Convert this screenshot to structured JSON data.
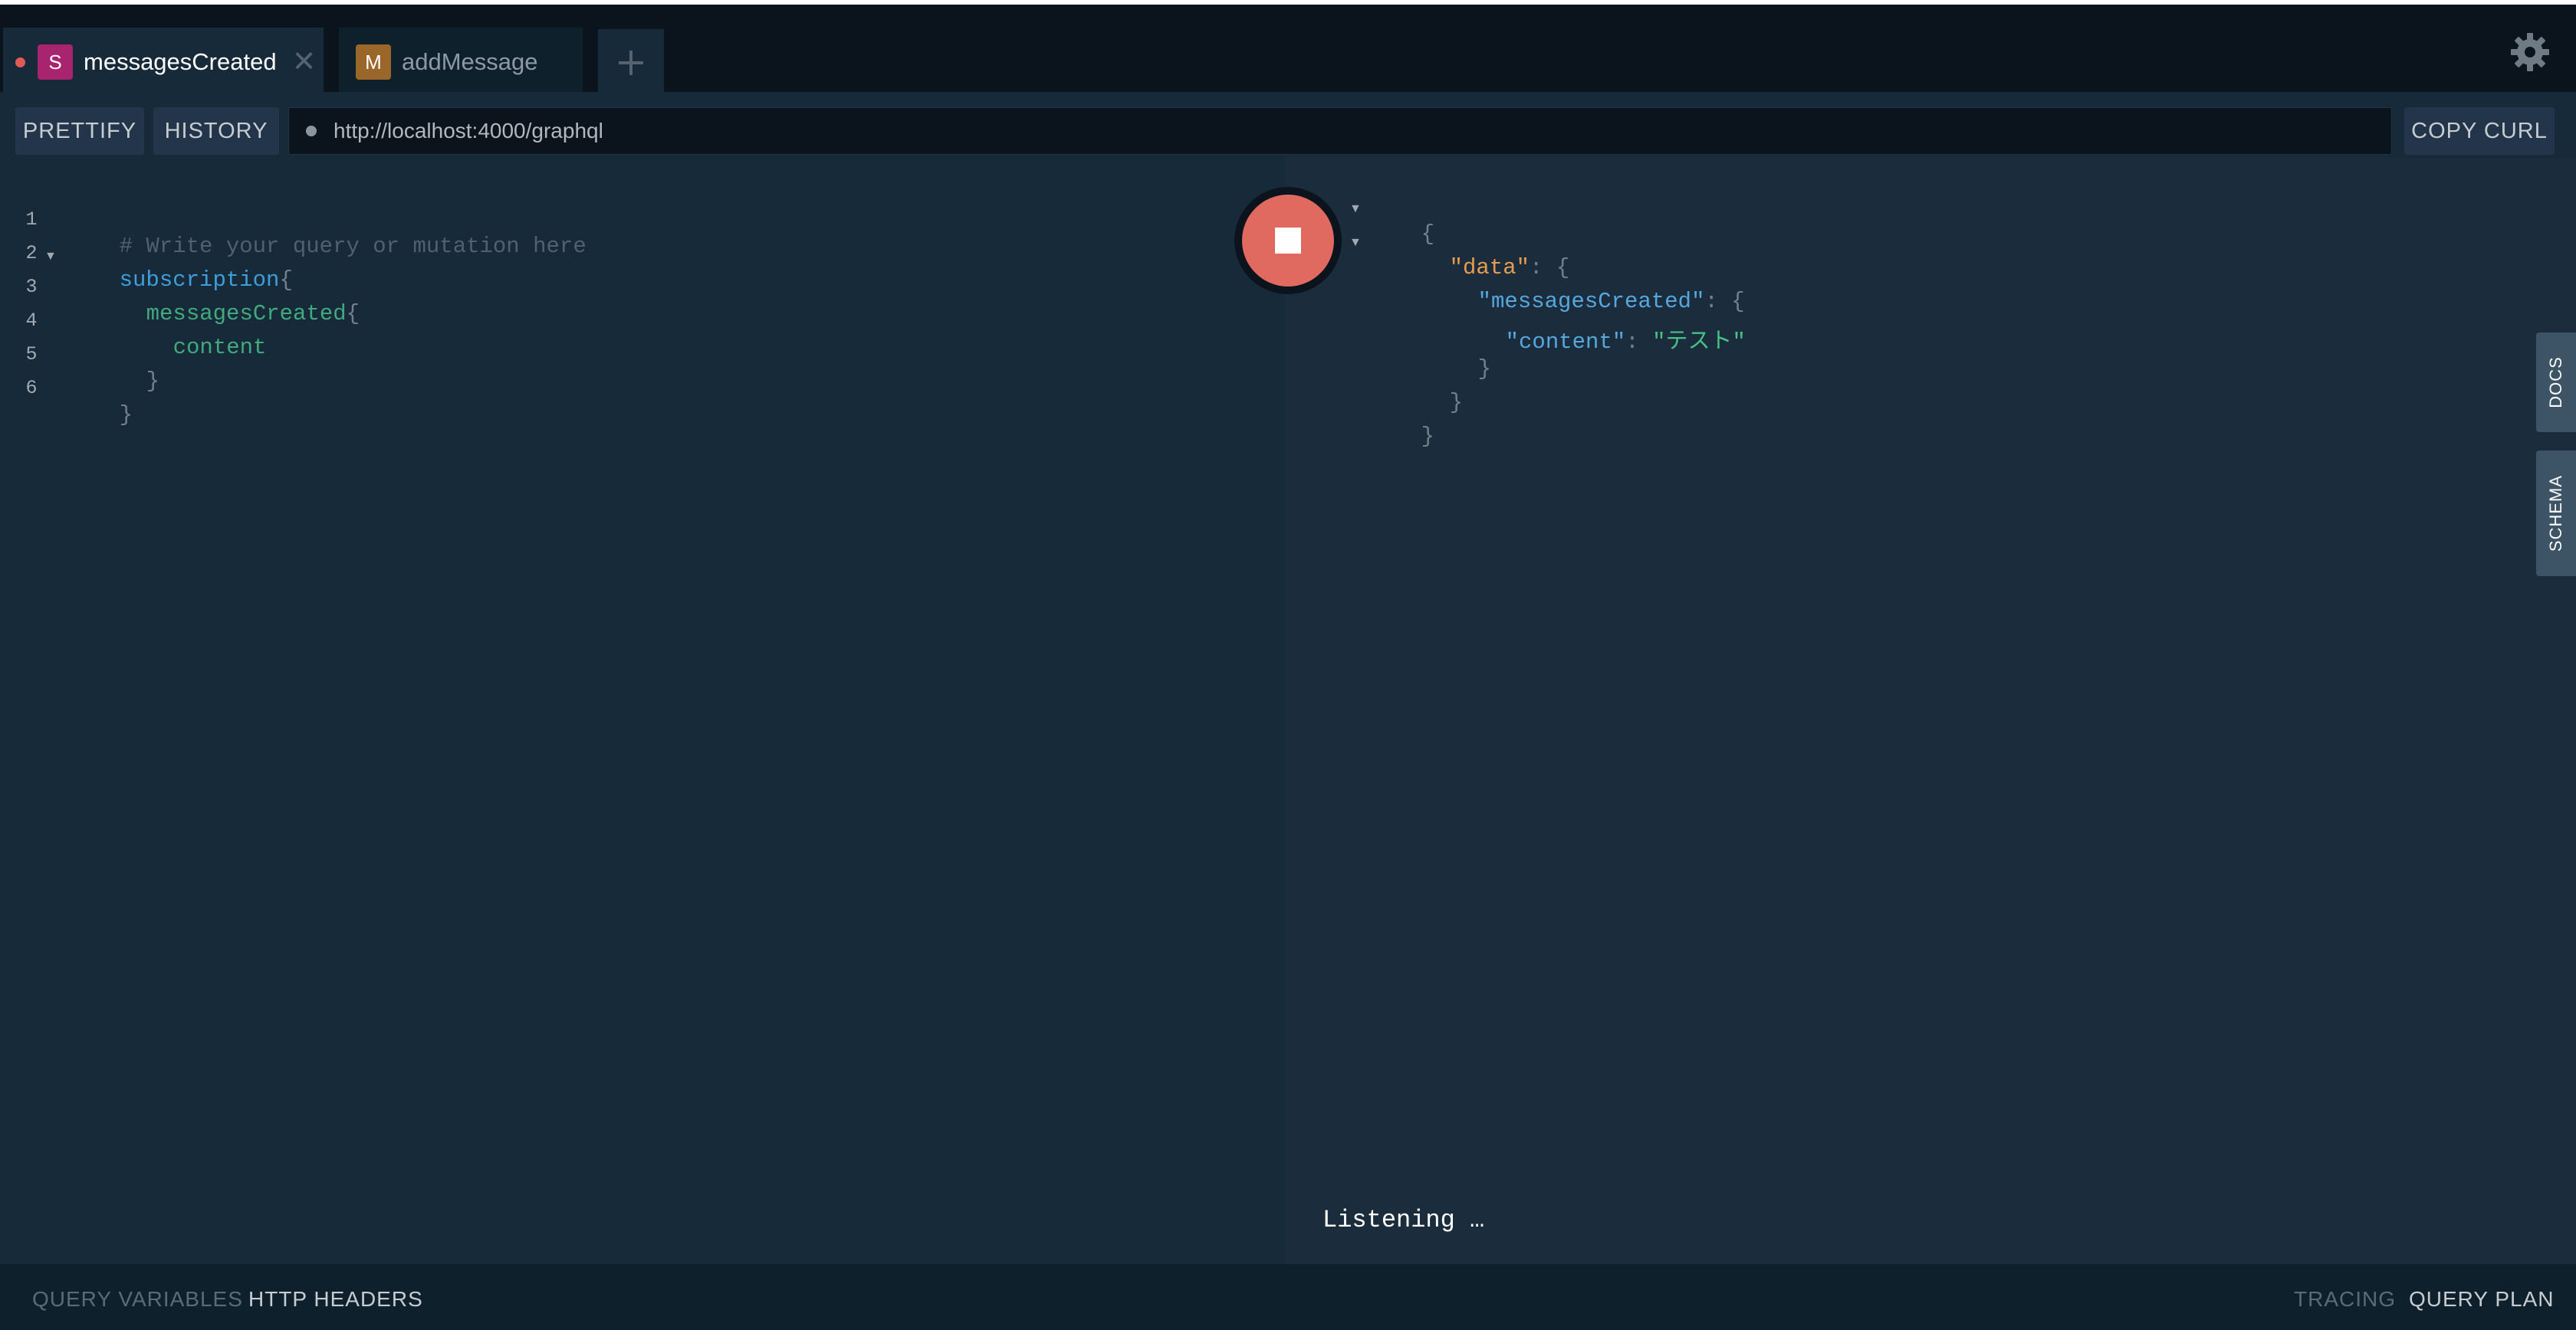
{
  "tabs": [
    {
      "badge": "S",
      "badge_color": "#a8246e",
      "label": "messagesCreated",
      "close": "✕"
    },
    {
      "badge": "M",
      "badge_color": "#9b6629",
      "label": "addMessage"
    }
  ],
  "new_tab_icon": "plus-icon",
  "settings_icon": "gear-icon",
  "toolbar": {
    "prettify": "PRETTIFY",
    "history": "HISTORY",
    "url": "http://localhost:4000/graphql",
    "copy_curl": "COPY CURL"
  },
  "editor": {
    "line_numbers": [
      "1",
      "2",
      "3",
      "4",
      "5",
      "6"
    ],
    "lines": [
      {
        "text": "# Write your query or mutation here"
      },
      {
        "keyword": "subscription",
        "punc": "{"
      },
      {
        "field": "messagesCreated",
        "punc": "{"
      },
      {
        "field": "content"
      },
      {
        "punc": "}"
      },
      {
        "punc": "}"
      }
    ]
  },
  "result": {
    "open_brace": "{",
    "data_key": "\"data\"",
    "messages_key": "\"messagesCreated\"",
    "content_key": "\"content\"",
    "content_value": "\"テスト\"",
    "colon": ": ",
    "brace_open": "{",
    "brace_close": "}",
    "fold_arrow": "▼"
  },
  "status": "Listening …",
  "side_tabs": {
    "docs": "DOCS",
    "schema": "SCHEMA"
  },
  "bottom": {
    "query_variables": "QUERY VARIABLES",
    "http_headers": "HTTP HEADERS",
    "tracing": "TRACING",
    "query_plan": "QUERY PLAN"
  }
}
